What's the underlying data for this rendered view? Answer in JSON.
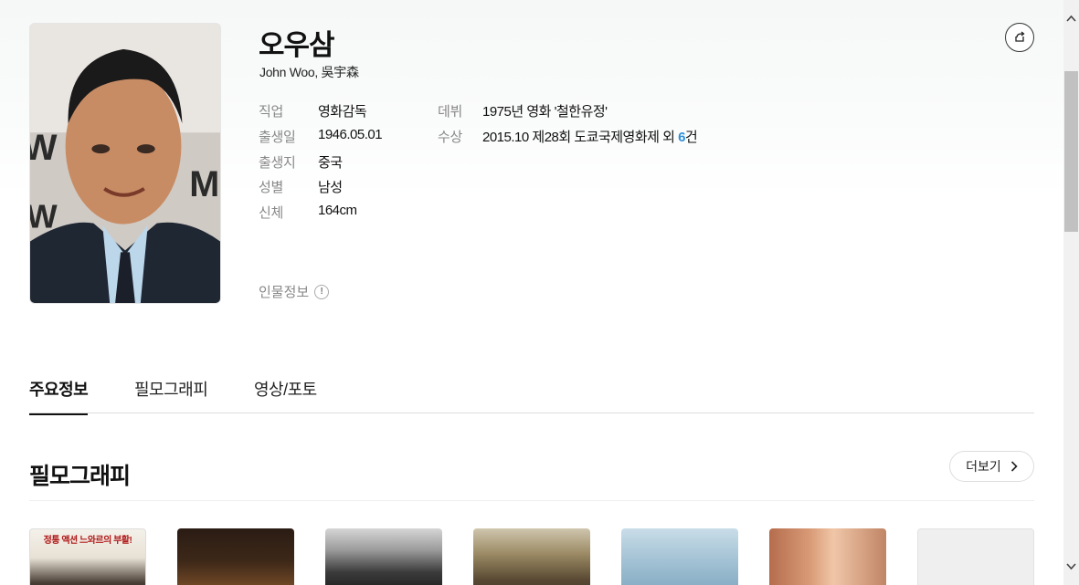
{
  "person": {
    "name": "오우삼",
    "name_en": "John Woo, 吳宇森",
    "photo_icon": "person-photo"
  },
  "info": {
    "job_label": "직업",
    "job_value": "영화감독",
    "birth_label": "출생일",
    "birth_value": "1946.05.01",
    "birthplace_label": "출생지",
    "birthplace_value": "중국",
    "gender_label": "성별",
    "gender_value": "남성",
    "body_label": "신체",
    "body_value": "164cm",
    "debut_label": "데뷔",
    "debut_value": "1975년 영화 '철한유정'",
    "award_label": "수상",
    "award_value_prefix": "2015.10 제28회 도쿄국제영화제 외 ",
    "award_count": "6",
    "award_suffix": "건"
  },
  "person_info_link": {
    "label": "인물정보",
    "icon": "!"
  },
  "tabs": [
    {
      "label": "주요정보",
      "active": true
    },
    {
      "label": "필모그래피",
      "active": false
    },
    {
      "label": "영상/포토",
      "active": false
    }
  ],
  "filmography": {
    "title": "필모그래피",
    "more_label": "더보기",
    "first_poster_text": "정통 액션 느와르의 부활!"
  },
  "colors": {
    "accent": "#2f8fd8",
    "text": "#111111",
    "muted": "#888888"
  }
}
